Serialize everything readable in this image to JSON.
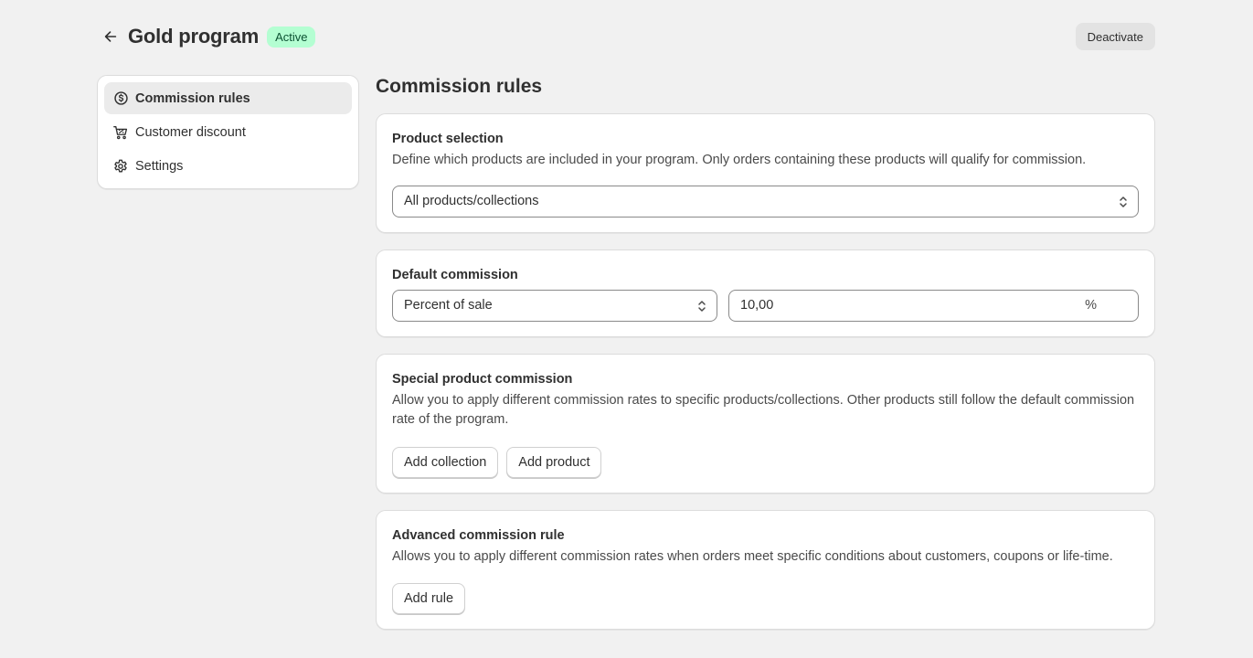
{
  "header": {
    "title": "Gold program",
    "status": "Active",
    "deactivate_label": "Deactivate"
  },
  "sidebar": {
    "items": [
      {
        "label": "Commission rules",
        "icon": "dollar-circle-icon",
        "active": true
      },
      {
        "label": "Customer discount",
        "icon": "cart-discount-icon",
        "active": false
      },
      {
        "label": "Settings",
        "icon": "gear-icon",
        "active": false
      }
    ]
  },
  "main": {
    "title": "Commission rules",
    "product_selection": {
      "title": "Product selection",
      "description": "Define which products are included in your program. Only orders containing these products will qualify for commission.",
      "select_value": "All products/collections"
    },
    "default_commission": {
      "title": "Default commission",
      "type_value": "Percent of sale",
      "rate_value": "10,00",
      "rate_suffix": "%"
    },
    "special_commission": {
      "title": "Special product commission",
      "description": "Allow you to apply different commission rates to specific products/collections. Other products still follow the default commission rate of the program.",
      "add_collection_label": "Add collection",
      "add_product_label": "Add product"
    },
    "advanced_rule": {
      "title": "Advanced commission rule",
      "description": "Allows you to apply different commission rates when orders meet specific conditions about customers, coupons or life-time.",
      "add_rule_label": "Add rule"
    }
  },
  "colors": {
    "background": "#f1f1f1",
    "badge_bg": "#b4fed2",
    "badge_text": "#0c5132",
    "card_bg": "#ffffff"
  }
}
